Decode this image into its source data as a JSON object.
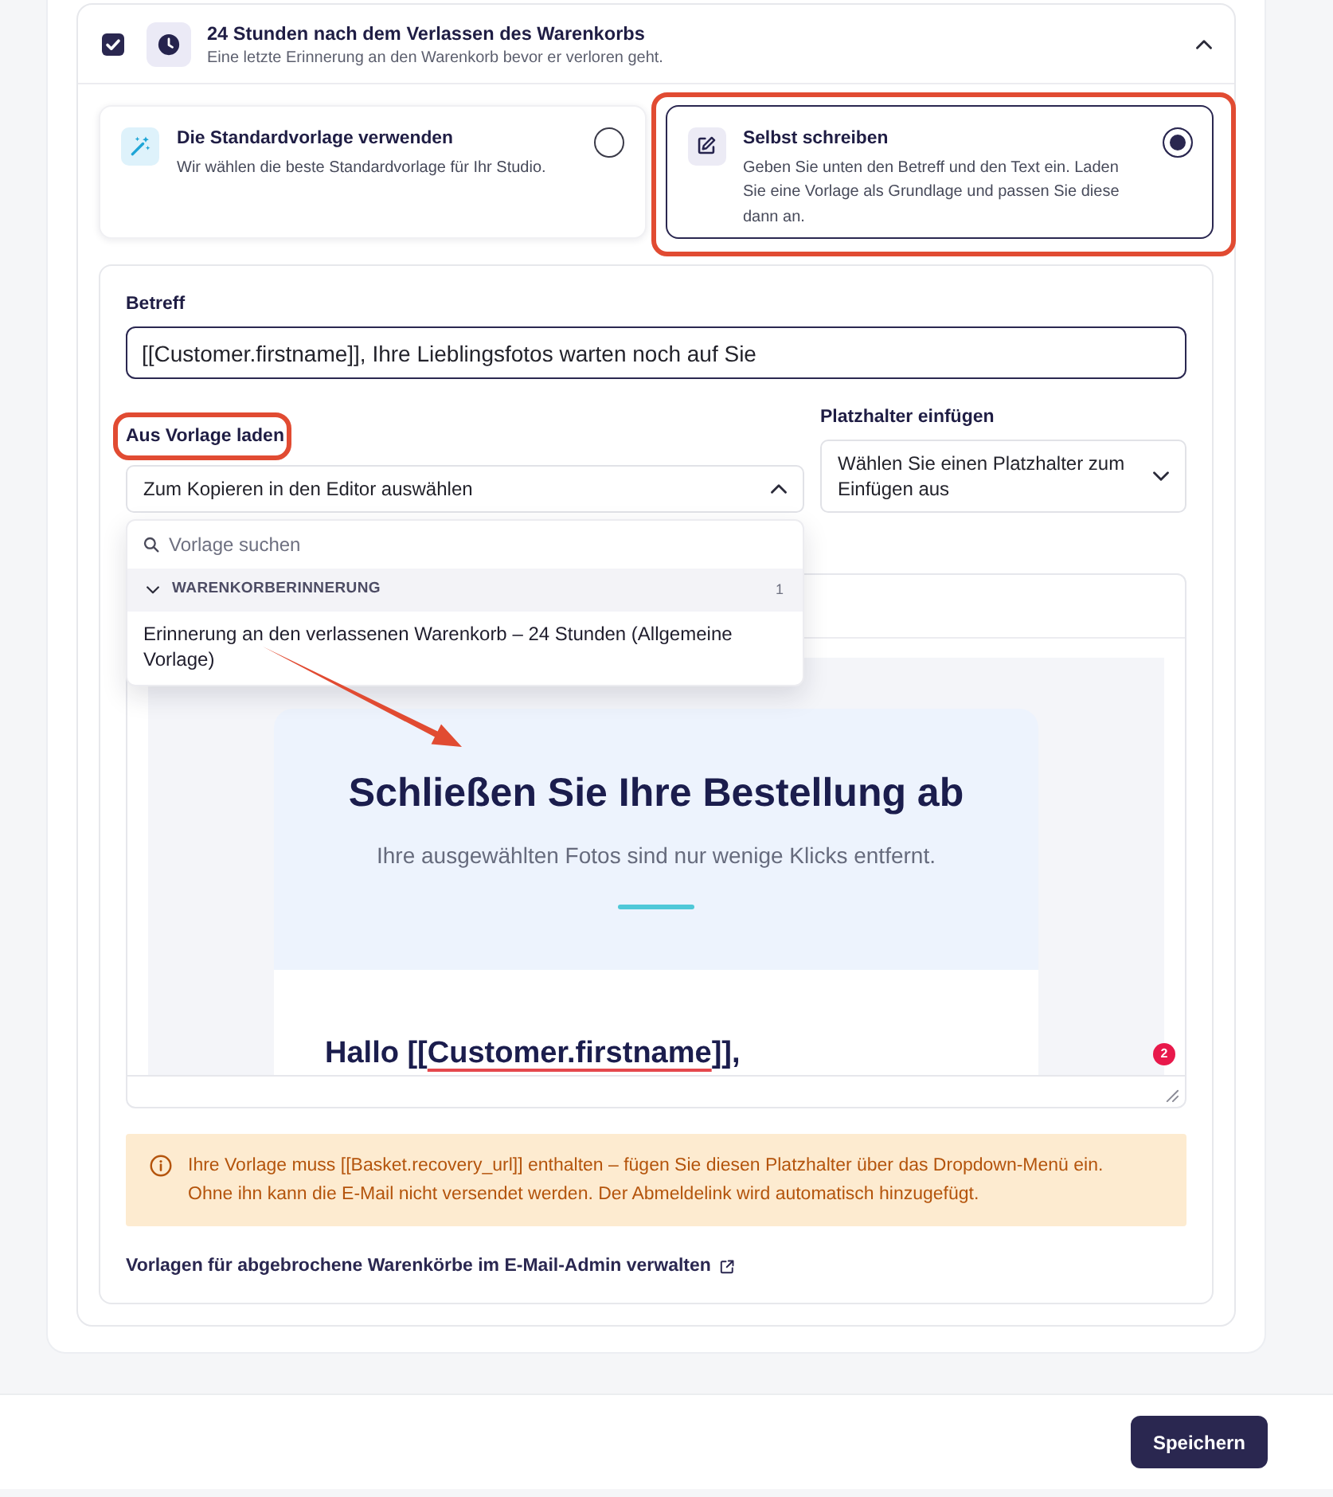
{
  "section": {
    "checked": true,
    "title": "24 Stunden nach dem Verlassen des Warenkorbs",
    "subtitle": "Eine letzte Erinnerung an den Warenkorb bevor er verloren geht.",
    "expanded": true
  },
  "options": [
    {
      "kind": "default",
      "title": "Die Standardvorlage verwenden",
      "description": "Wir wählen die beste Standardvorlage für Ihr Studio.",
      "selected": false,
      "highlighted": false
    },
    {
      "kind": "custom",
      "title": "Selbst schreiben",
      "description": "Geben Sie unten den Betreff und den Text ein. Laden Sie eine Vorlage als Grundlage und passen Sie diese dann an.",
      "selected": true,
      "highlighted": true
    }
  ],
  "subject": {
    "label": "Betreff",
    "value": "[[Customer.firstname]], Ihre Lieblingsfotos warten noch auf Sie"
  },
  "template_picker": {
    "label": "Aus Vorlage laden",
    "label_highlighted": true,
    "prompt": "Zum Kopieren in den Editor auswählen",
    "expanded": true,
    "search": {
      "placeholder": "Vorlage suchen"
    },
    "groups": [
      {
        "name": "WARENKORBERINNERUNG",
        "count": "1",
        "expanded": true,
        "items": [
          {
            "label": "Erinnerung an den verlassenen Warenkorb – 24 Stunden (Allgemeine Vorlage)",
            "arrow_annotation": true
          }
        ]
      }
    ]
  },
  "placeholder_picker": {
    "label": "Platzhalter einfügen",
    "prompt": "Wählen Sie einen Platzhalter zum Einfügen aus",
    "expanded": false
  },
  "editor": {
    "email": {
      "heading": "Schließen Sie Ihre Bestellung ab",
      "subheading": "Ihre ausgewählten Fotos sind nur wenige Klicks entfernt.",
      "greeting": [
        {
          "text": "Hallo [[",
          "flagged": false
        },
        {
          "text": "Customer.firstname",
          "flagged": true
        },
        {
          "text": "]],",
          "flagged": false
        }
      ]
    },
    "issue_count": "2"
  },
  "notice": {
    "kind": "warning",
    "text": "Ihre Vorlage muss [[Basket.recovery_url]] enthalten – fügen Sie diesen Platzhalter über das Dropdown-Menü ein. Ohne ihn kann die E-Mail nicht versendet werden. Der Abmeldelink wird automatisch hinzugefügt."
  },
  "admin_link": {
    "label": "Vorlagen für abgebrochene Warenkörbe im E-Mail-Admin verwalten",
    "external": true
  },
  "footer": {
    "save_button": "Speichern"
  }
}
